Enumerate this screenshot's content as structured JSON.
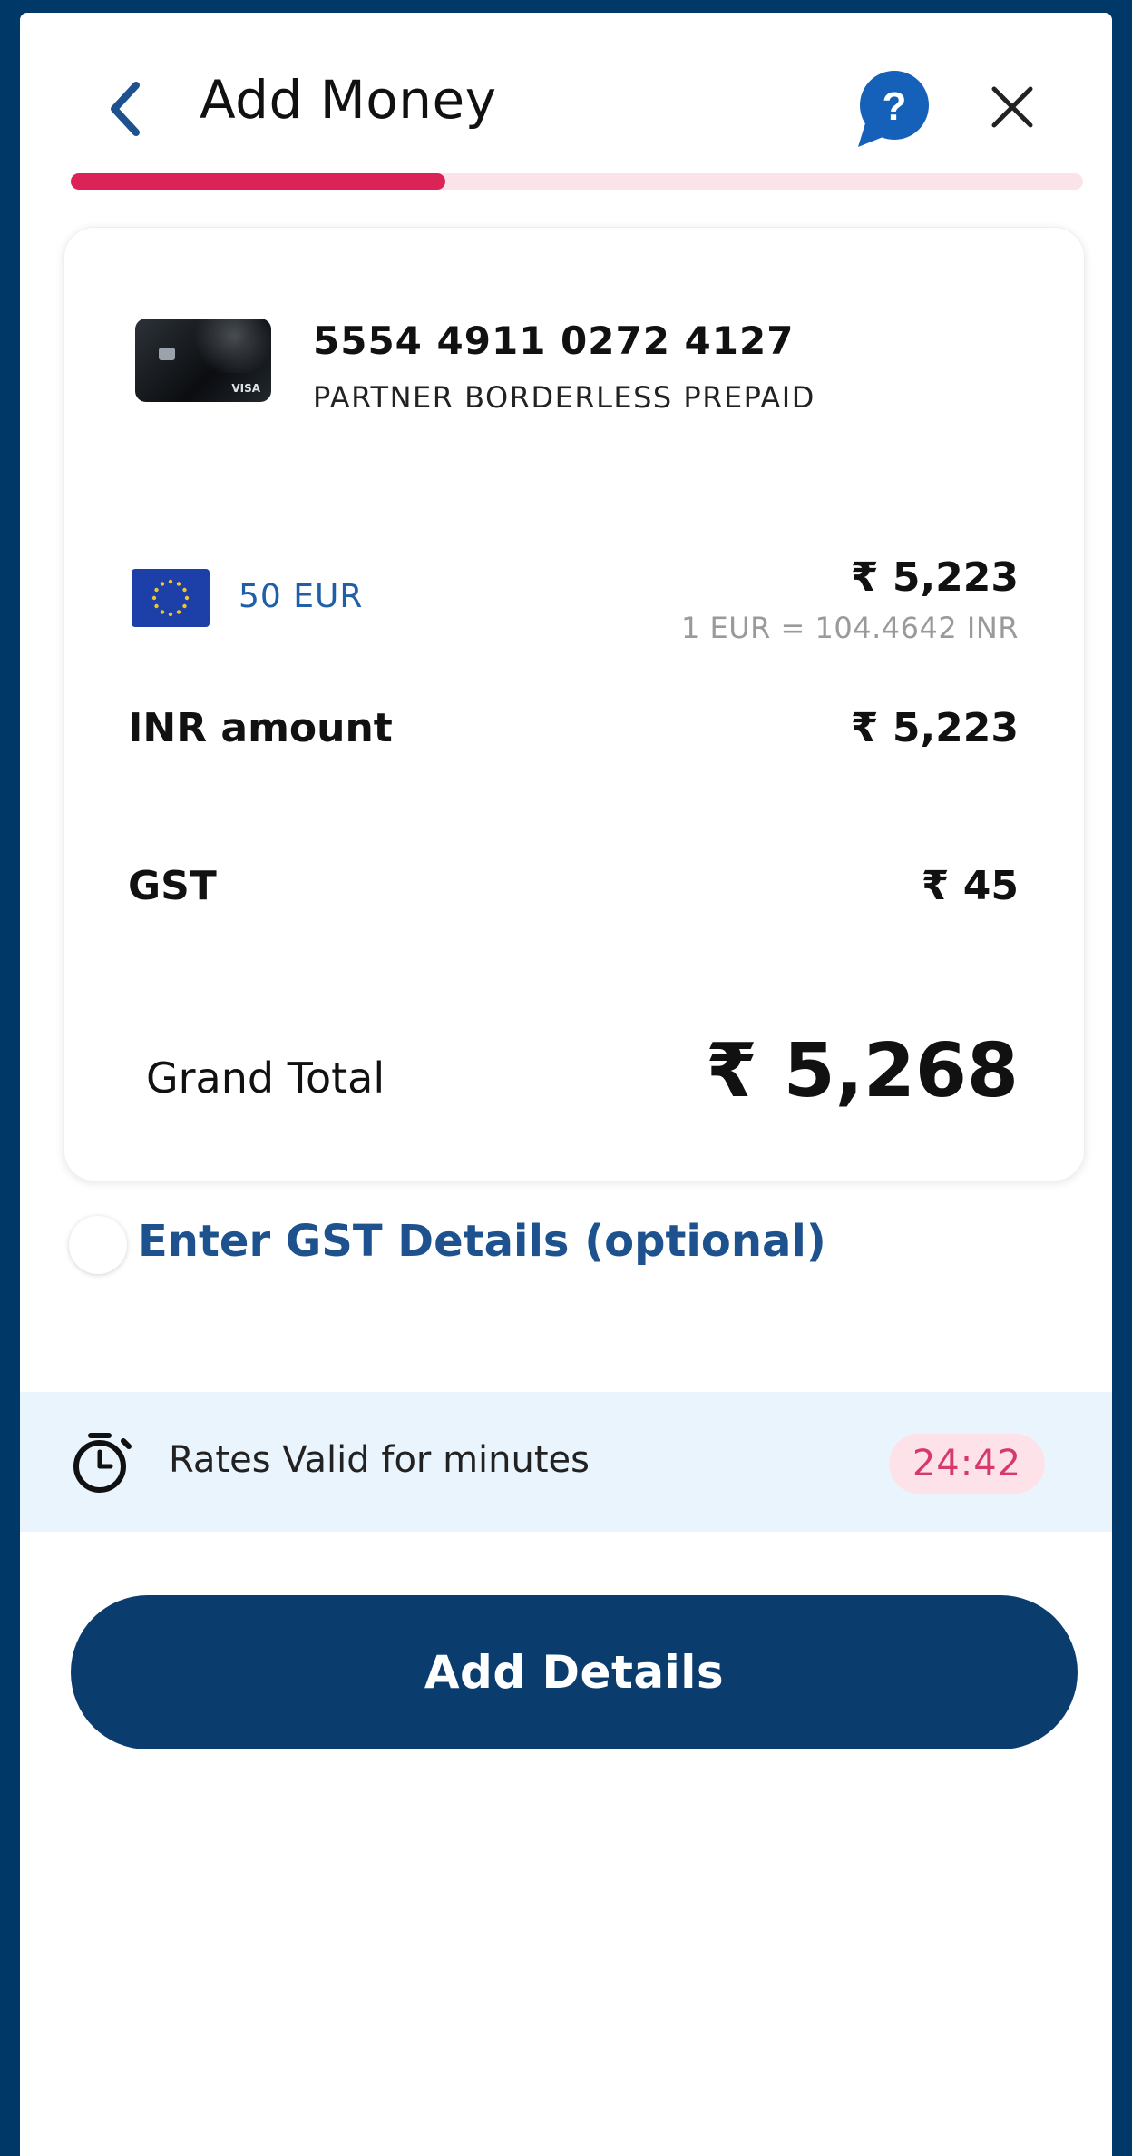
{
  "header": {
    "title": "Add Money",
    "back_icon": "chevron-left-icon",
    "help_icon": "help-bubble-icon",
    "close_icon": "close-icon",
    "progress": 0.37
  },
  "card": {
    "number": "5554 4911 0272 4127",
    "type": "PARTNER BORDERLESS PREPAID"
  },
  "conversion": {
    "fx_amount": "50 EUR",
    "inr_converted": "₹ 5,223",
    "rate": "1 EUR = 104.4642 INR"
  },
  "breakdown": {
    "inr_amount_label": "INR amount",
    "inr_amount_value": "₹ 5,223",
    "gst_label": "GST",
    "gst_value": "₹ 45",
    "grand_total_label": "Grand Total",
    "grand_total_value": "₹ 5,268"
  },
  "gst_details": {
    "label": "Enter GST Details (optional)",
    "checked": false
  },
  "rates": {
    "text": "Rates Valid for minutes",
    "countdown": "24:42"
  },
  "cta": {
    "label": "Add Details"
  },
  "colors": {
    "frame": "#003868",
    "accent": "#dc2358",
    "primary_button": "#0a3c6e",
    "link": "#1d528e"
  }
}
